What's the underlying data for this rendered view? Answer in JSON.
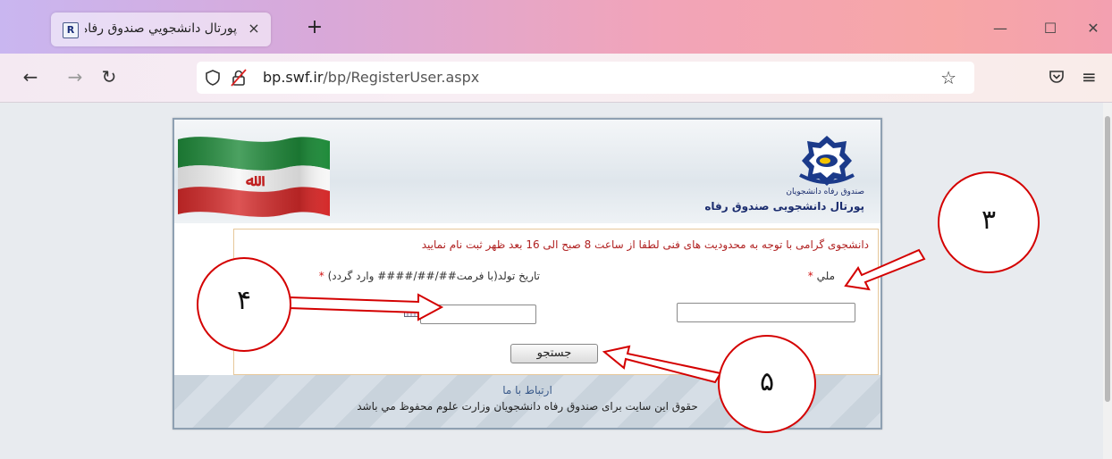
{
  "browser": {
    "tab_title": "پورتال دانشجويي صندوق رفاه",
    "tab_favicon_letter": "R",
    "tab_close": "×",
    "new_tab": "+",
    "window": {
      "minimize": "—",
      "maximize": "☐",
      "close": "✕"
    },
    "url_host": "bp.swf.ir",
    "url_path": "/bp/RegisterUser.aspx",
    "icons": [
      "back-icon",
      "forward-icon",
      "reload-icon",
      "shield-icon",
      "lock-icon",
      "star-icon",
      "pocket-icon",
      "menu-icon"
    ]
  },
  "page": {
    "portal_title": "پورتال دانشجویی صندوق رفاه",
    "logo_caption": "صندوق رفاه دانشجویان",
    "notice": "دانشجوی گرامی با توجه به محدودیت های فنی لطفا از ساعت 8 صبح الی 16 بعد ظهر ثبت نام نمایید",
    "national_code_label": "ملي",
    "birthdate_label": "تاریخ تولد(با فرمت##/##/#### وارد گردد)",
    "required_mark": "*",
    "national_code_value": "",
    "birthdate_value": "",
    "search_button": "جستجو",
    "contact_link": "ارتباط با ما",
    "copyright": "حقوق این سایت برای صندوق رفاه دانشجویان وزارت علوم محفوظ مي باشد"
  },
  "annotations": {
    "label_3": "۳",
    "label_4": "۴",
    "label_5": "۵",
    "color": "#d40000"
  }
}
